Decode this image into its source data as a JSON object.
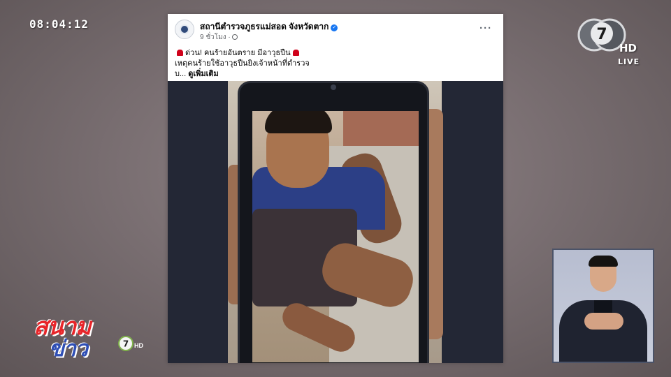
{
  "clock": "08:04:12",
  "channel": {
    "hd_label": "HD",
    "live_label": "LIVE",
    "number": "7"
  },
  "post": {
    "page_name": "สถานีตำรวจภูธรแม่สอด จังหวัดตาก",
    "time_ago": "9 ชั่วโมง ·",
    "line1": "ด่วน! คนร้ายอันตราย มีอาวุธปืน",
    "line2": "เหตุคนร้ายใช้อาวุธปืนยิงเจ้าหน้าที่ตำรวจ",
    "line3_prefix": "บ...",
    "see_more": "ดูเพิ่มเติม",
    "more_menu": "···"
  },
  "program_logo": {
    "top": "สนาม",
    "bottom": "ข่าว",
    "hd": "HD"
  },
  "colors": {
    "brand_red": "#e8262a",
    "brand_blue": "#2f4fb5",
    "fb_blue": "#1877f2"
  },
  "icons": [
    "verified-badge-icon",
    "globe-icon",
    "more-options-icon",
    "siren-icon",
    "channel-7-logo-icon"
  ]
}
